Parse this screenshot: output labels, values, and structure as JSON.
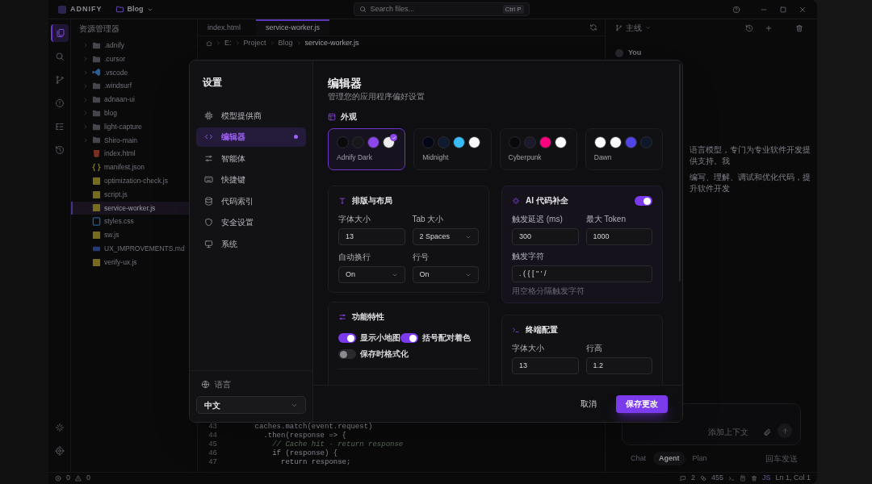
{
  "app": {
    "name": "ADNIFY",
    "project": "Blog",
    "search": {
      "placeholder": "Search files..."
    },
    "shortcut": "Ctrl P"
  },
  "activity_bar": [
    {
      "kind": "files",
      "selected": true
    },
    {
      "kind": "search",
      "selected": false
    },
    {
      "kind": "branch",
      "selected": false
    },
    {
      "kind": "problems",
      "selected": false
    },
    {
      "kind": "outline",
      "selected": false
    },
    {
      "kind": "history",
      "selected": false
    },
    {
      "kind": "sparkle",
      "selected": false
    },
    {
      "kind": "settings",
      "selected": false
    }
  ],
  "explorer": {
    "title": "资源管理器",
    "items": [
      {
        "label": ".adnify",
        "kind": "folder",
        "selected": false
      },
      {
        "label": ".cursor",
        "kind": "folder",
        "selected": false
      },
      {
        "label": ".vscode",
        "kind": "vscode",
        "selected": false
      },
      {
        "label": ".windsurf",
        "kind": "folder",
        "selected": false
      },
      {
        "label": "adnaan-ui",
        "kind": "folder",
        "selected": false
      },
      {
        "label": "blog",
        "kind": "folder",
        "selected": false
      },
      {
        "label": "light-capture",
        "kind": "folder",
        "selected": false
      },
      {
        "label": "Shiro-main",
        "kind": "folder",
        "selected": false
      },
      {
        "label": "index.html",
        "kind": "html",
        "selected": false
      },
      {
        "label": "manifest.json",
        "kind": "json",
        "selected": false
      },
      {
        "label": "optimization-check.js",
        "kind": "js",
        "selected": false
      },
      {
        "label": "script.js",
        "kind": "js",
        "selected": false
      },
      {
        "label": "service-worker.js",
        "kind": "js",
        "selected": true
      },
      {
        "label": "styles.css",
        "kind": "css",
        "selected": false
      },
      {
        "label": "sw.js",
        "kind": "js",
        "selected": false
      },
      {
        "label": "UX_IMPROVEMENTS.md",
        "kind": "md",
        "selected": false
      },
      {
        "label": "verify-ux.js",
        "kind": "js",
        "selected": false
      }
    ]
  },
  "editor": {
    "tabs": [
      {
        "label": "index.html",
        "selected": false
      },
      {
        "label": "service-worker.js",
        "selected": true
      }
    ],
    "breadcrumb": [
      "E:",
      "Project",
      "Blog",
      "service-worker.js"
    ],
    "lines": [
      {
        "number": "43",
        "code": "    caches.match(event.request)",
        "kind": "code"
      },
      {
        "number": "44",
        "code": "      .then(response => {",
        "kind": "code"
      },
      {
        "number": "45",
        "code": "        // Cache hit - return response",
        "kind": "comment"
      },
      {
        "number": "46",
        "code": "        if (response) {",
        "kind": "code"
      },
      {
        "number": "47",
        "code": "          return response;",
        "kind": "code"
      }
    ]
  },
  "chat": {
    "branch": "主线",
    "user": "You",
    "message_lines": [
      "语言模型，专门为专业软件开发提供支持。我",
      "编写、理解、调试和优化代码，提升软件开发"
    ],
    "input": {
      "placeholder": "添加上下文"
    },
    "modes": [
      {
        "label": "Chat",
        "selected": false
      },
      {
        "label": "Agent",
        "selected": true
      },
      {
        "label": "Plan",
        "selected": false
      }
    ],
    "hint": "回车发送"
  },
  "status_bar": {
    "errors": "0",
    "warnings": "0",
    "comments": "2",
    "tokens": "455",
    "language": "JS",
    "position": "Ln 1, Col 1"
  },
  "settings": {
    "title": "设置",
    "nav": [
      {
        "label": "模型提供商",
        "kind": "provider",
        "selected": false
      },
      {
        "label": "编辑器",
        "kind": "editor",
        "selected": true
      },
      {
        "label": "智能体",
        "kind": "agent",
        "selected": false
      },
      {
        "label": "快捷键",
        "kind": "keys",
        "selected": false
      },
      {
        "label": "代码索引",
        "kind": "index",
        "selected": false
      },
      {
        "label": "安全设置",
        "kind": "security",
        "selected": false
      },
      {
        "label": "系统",
        "kind": "system",
        "selected": false
      }
    ],
    "language": {
      "label": "语言",
      "value": "中文"
    },
    "page": {
      "title": "编辑器",
      "subtitle": "管理您的应用程序偏好设置"
    },
    "appearance": {
      "title": "外观",
      "themes": [
        {
          "name": "Adnify Dark",
          "selected": true,
          "swatches": [
            {
              "color": "#0b0b0d"
            },
            {
              "color": "#18181b"
            },
            {
              "color": "#8b45ea"
            },
            {
              "color": "#ededef"
            }
          ]
        },
        {
          "name": "Midnight",
          "selected": false,
          "swatches": [
            {
              "color": "#020617"
            },
            {
              "color": "#0f1a30"
            },
            {
              "color": "#38bdf8"
            },
            {
              "color": "#f8fafc"
            }
          ]
        },
        {
          "name": "Cyberpunk",
          "selected": false,
          "swatches": [
            {
              "color": "#09090b"
            },
            {
              "color": "#1a1a2a"
            },
            {
              "color": "#ff007f"
            },
            {
              "color": "#ffffff"
            }
          ]
        },
        {
          "name": "Dawn",
          "selected": false,
          "swatches": [
            {
              "color": "#ffffff"
            },
            {
              "color": "#fafafa"
            },
            {
              "color": "#4f46e5"
            },
            {
              "color": "#0f172a"
            }
          ]
        }
      ]
    },
    "typography": {
      "title": "排版与布局",
      "fields": [
        {
          "label": "字体大小",
          "value": "13",
          "kind": "input"
        },
        {
          "label": "Tab 大小",
          "value": "2 Spaces",
          "kind": "select"
        },
        {
          "label": "自动换行",
          "value": "On",
          "kind": "select"
        },
        {
          "label": "行号",
          "value": "On",
          "kind": "select"
        }
      ]
    },
    "ai_completion": {
      "title": "AI 代码补全",
      "on": true,
      "fields": [
        {
          "label": "触发延迟 (ms)",
          "value": "300"
        },
        {
          "label": "最大 Token",
          "value": "1000"
        }
      ],
      "trigger": {
        "label": "触发字符",
        "value": ". ( { [ \" ' /",
        "hint": "用空格分隔触发字符"
      }
    },
    "features": {
      "title": "功能特性",
      "toggles": [
        {
          "label": "显示小地图",
          "on": true
        },
        {
          "label": "括号配对着色",
          "on": true
        },
        {
          "label": "保存时格式化",
          "on": false
        }
      ]
    },
    "terminal": {
      "title": "终端配置",
      "fields": [
        {
          "label": "字体大小",
          "value": "13"
        },
        {
          "label": "行高",
          "value": "1.2"
        }
      ]
    },
    "footer": {
      "cancel": "取消",
      "save": "保存更改"
    }
  }
}
